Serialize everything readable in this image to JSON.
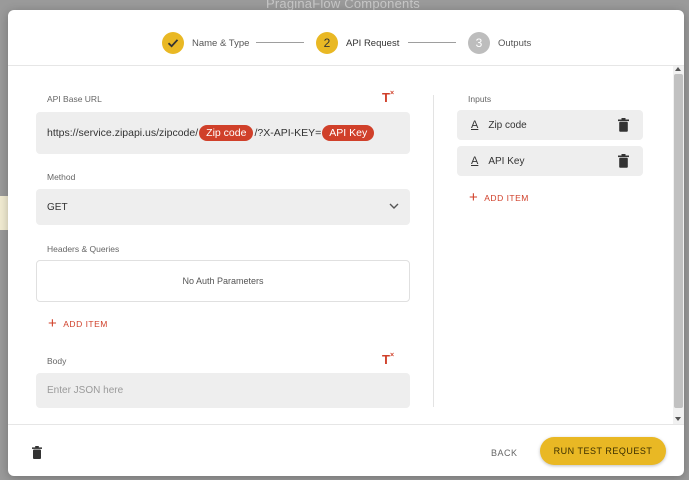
{
  "background": {
    "title": "PraginaFlow Components"
  },
  "stepper": {
    "steps": [
      {
        "label": "Name & Type",
        "number": "1",
        "state": "done"
      },
      {
        "label": "API Request",
        "number": "2",
        "state": "active"
      },
      {
        "label": "Outputs",
        "number": "3",
        "state": "pending"
      }
    ]
  },
  "form": {
    "api_base_url_label": "API Base URL",
    "url_prefix": "https://service.zipapi.us/zipcode/",
    "url_chip_1": "Zip code",
    "url_middle": "/?X-API-KEY=",
    "url_chip_2": "API Key",
    "method_label": "Method",
    "method_value": "GET",
    "headers_label": "Headers & Queries",
    "headers_empty": "No Auth Parameters",
    "add_item_label": "ADD ITEM",
    "body_label": "Body",
    "body_placeholder": "Enter JSON here"
  },
  "inputs_panel": {
    "title": "Inputs",
    "items": [
      {
        "label": "Zip code"
      },
      {
        "label": "API Key"
      }
    ],
    "add_item_label": "ADD ITEM"
  },
  "footer": {
    "back_label": "BACK",
    "run_label": "RUN TEST REQUEST"
  },
  "colors": {
    "accent": "#e9b824",
    "chip": "#d0402a",
    "add": "#d0402a"
  }
}
